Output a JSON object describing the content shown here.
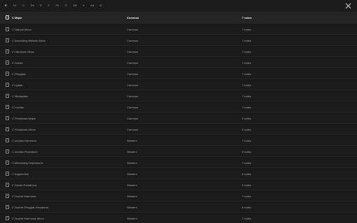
{
  "key_tabs": [
    "C",
    "C#",
    "D",
    "D#",
    "E",
    "F",
    "F#",
    "G",
    "G#",
    "A",
    "A#",
    "B"
  ],
  "selected_key": "C",
  "header": {
    "name": "C Major",
    "type": "Common",
    "notes": "7 notes"
  },
  "scales": [
    {
      "name": "C Natural Minor",
      "type": "Common",
      "notes": "7 notes"
    },
    {
      "name": "C Ascending Melodic Minor",
      "type": "Common",
      "notes": "7 notes"
    },
    {
      "name": "C Harmonic Minor",
      "type": "Common",
      "notes": "7 notes"
    },
    {
      "name": "C Dorian",
      "type": "Common",
      "notes": "7 notes"
    },
    {
      "name": "C Phrygian",
      "type": "Common",
      "notes": "7 notes"
    },
    {
      "name": "C Lydian",
      "type": "Common",
      "notes": "7 notes"
    },
    {
      "name": "C Mixolydian",
      "type": "Common",
      "notes": "7 notes"
    },
    {
      "name": "C Locrian",
      "type": "Common",
      "notes": "7 notes"
    },
    {
      "name": "C Pentatonic Major",
      "type": "Common",
      "notes": "5 notes"
    },
    {
      "name": "C Pentatonic Minor",
      "type": "Common",
      "notes": "5 notes"
    },
    {
      "name": "C Aeolian Harmonic",
      "type": "Western",
      "notes": "7 notes"
    },
    {
      "name": "C Aeolian Pentatonic",
      "type": "Western",
      "notes": "5 notes"
    },
    {
      "name": "C Alternating Heptamode",
      "type": "Western",
      "notes": "7 notes"
    },
    {
      "name": "C Augmented",
      "type": "Western",
      "notes": "6 notes"
    },
    {
      "name": "C Dorian Pentatonic",
      "type": "Western",
      "notes": "5 notes"
    },
    {
      "name": "C Double Harmonic",
      "type": "Western",
      "notes": "7 notes"
    },
    {
      "name": "C Double Phrygian Hexatonic",
      "type": "Western",
      "notes": "6 notes"
    },
    {
      "name": "C Double Harmonic Minor",
      "type": "Western",
      "notes": "7 notes"
    }
  ]
}
